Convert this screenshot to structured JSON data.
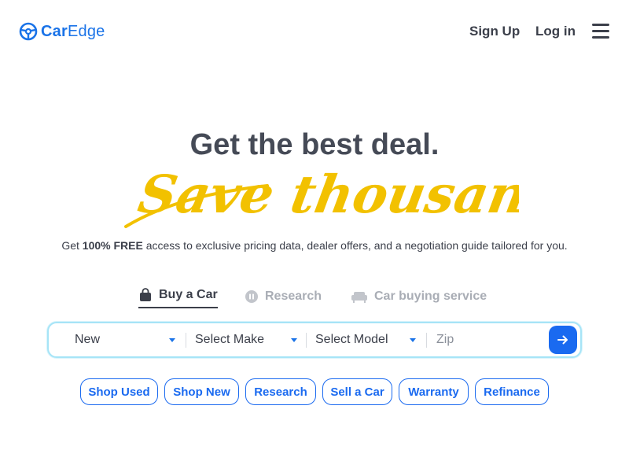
{
  "brand": {
    "logo_part1": "Car",
    "logo_part2": "Edge",
    "color": "#1a73e8"
  },
  "nav": {
    "signup": "Sign Up",
    "login": "Log in"
  },
  "hero": {
    "title": "Get the best deal.",
    "script_text": "Save thousands!",
    "script_color": "#f2c100",
    "subtitle_pre": "Get ",
    "subtitle_bold": "100% FREE",
    "subtitle_post": " access to exclusive pricing data, dealer offers, and a negotiation guide tailored for you."
  },
  "tabs": [
    {
      "label": "Buy a Car",
      "icon": "shopping-bag-icon",
      "active": true
    },
    {
      "label": "Research",
      "icon": "research-icon",
      "active": false
    },
    {
      "label": "Car buying service",
      "icon": "sofa-icon",
      "active": false
    }
  ],
  "search": {
    "condition": "New",
    "make": "Select Make",
    "model": "Select Model",
    "zip_placeholder": "Zip",
    "submit_icon": "arrow-right-icon",
    "accent": "#1a6af0"
  },
  "quick_links": [
    "Shop Used",
    "Shop New",
    "Research",
    "Sell a Car",
    "Warranty",
    "Refinance"
  ]
}
